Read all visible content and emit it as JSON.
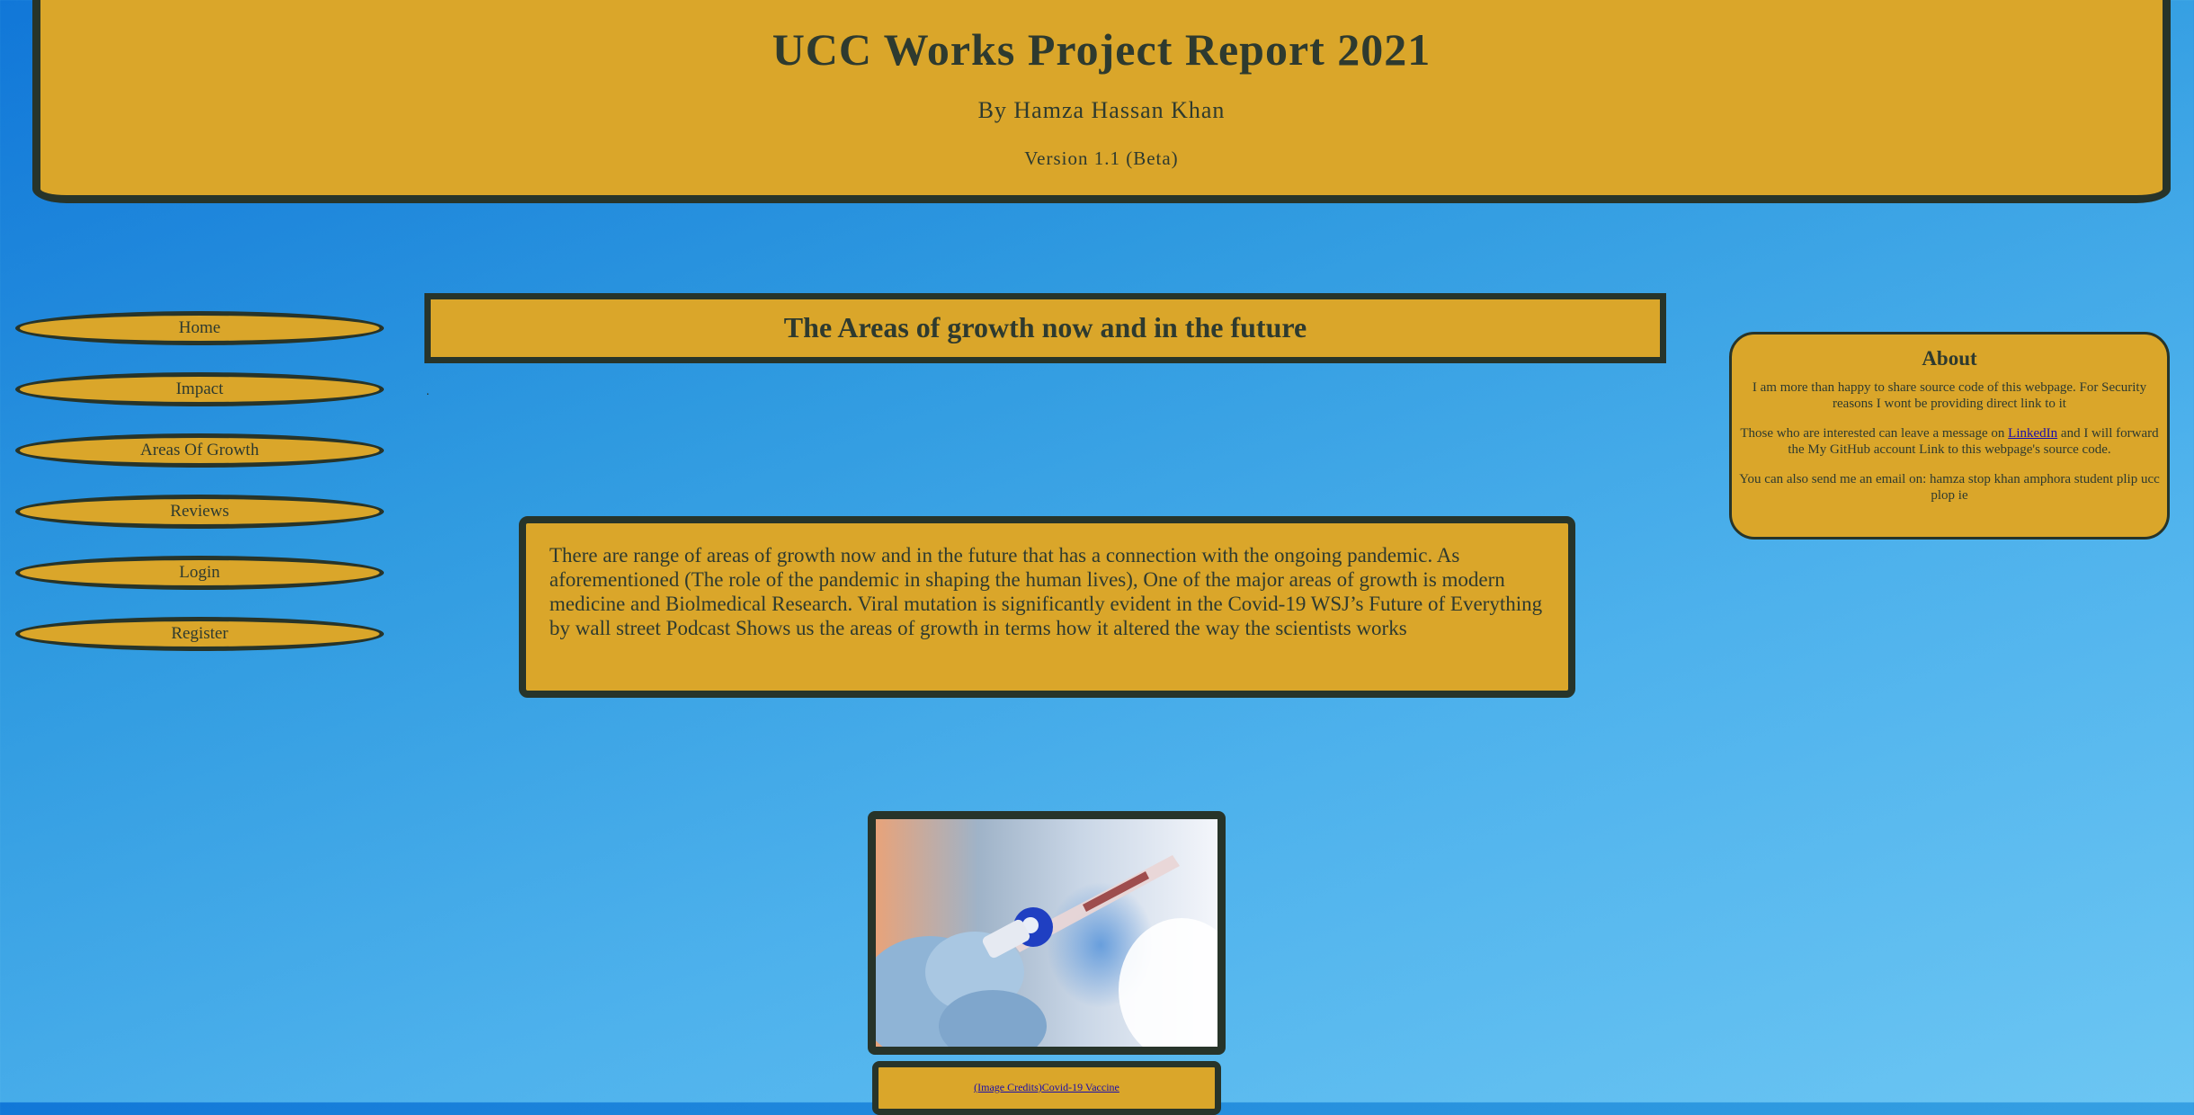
{
  "header": {
    "title": "UCC Works Project Report 2021",
    "byline": "By Hamza Hassan Khan",
    "version": "Version 1.1 (Beta)"
  },
  "nav": {
    "items": [
      {
        "label": "Home"
      },
      {
        "label": "Impact"
      },
      {
        "label": "Areas Of Growth"
      },
      {
        "label": "Reviews"
      },
      {
        "label": "Login"
      },
      {
        "label": "Register"
      }
    ]
  },
  "main": {
    "section_title": "The Areas of growth now and in the future",
    "dot": ".",
    "body_text": "There are range of areas of growth now and in the future that has a connection with the ongoing pandemic. As aforementioned (The role of the pandemic in shaping the human lives), One of the major areas of growth is modern medicine and Biolmedical Research. Viral mutation is significantly evident in the Covid-19 WSJ’s Future of Everything by wall street Podcast Shows us the areas of growth in terms how it altered the way the scientists works",
    "image_caption_prefix": "(Image Credits)",
    "image_caption_link": "Covid-19 Vaccine"
  },
  "about": {
    "title": "About",
    "paragraph1": "I am more than happy to share source code of this webpage. For Security reasons I wont be providing direct link to it",
    "paragraph2_before": "Those who are interested can leave a message on ",
    "paragraph2_link": "LinkedIn",
    "paragraph2_after": " and I will forward the My GitHub account Link to this webpage's source code.",
    "paragraph3": "You can also send me an email on: hamza stop khan amphora student plip ucc plop ie"
  },
  "colors": {
    "panel": "#daa62a",
    "border": "#27342a",
    "link": "#1a0dab"
  }
}
